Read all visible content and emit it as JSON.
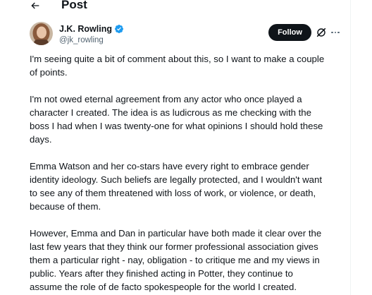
{
  "header": {
    "title": "Post"
  },
  "author": {
    "name": "J.K. Rowling",
    "handle": "@jk_rowling",
    "follow_label": "Follow"
  },
  "icons": {
    "back": "arrow-left-icon",
    "verified": "verified-badge-icon",
    "grok": "grok-icon",
    "more": "more-horizontal-icon"
  },
  "colors": {
    "text": "#0f1419",
    "secondary_text": "#536471",
    "verified_blue": "#1d9bf0",
    "follow_bg": "#0f1419"
  },
  "post": {
    "paragraphs": [
      "I'm seeing quite a bit of comment about this, so I want to make a couple\nof points.",
      "I'm not owed eternal agreement from any actor who once played a\ncharacter I created. The idea is as ludicrous as me checking with the\nboss I had when I was twenty-one for what opinions I should hold these\ndays.",
      "Emma Watson and her co-stars have every right to embrace gender\nidentity ideology. Such beliefs are legally protected, and I wouldn't want\nto see any of them threatened with loss of work, or violence, or death,\nbecause of them.",
      "However, Emma and Dan in particular have both made it clear over the\nlast few years that they think our former professional association gives\nthem a particular right - nay, obligation - to critique me and my views in\npublic. Years after they finished acting in Potter, they continue to\nassume the role of de facto spokespeople for the world I created."
    ]
  }
}
